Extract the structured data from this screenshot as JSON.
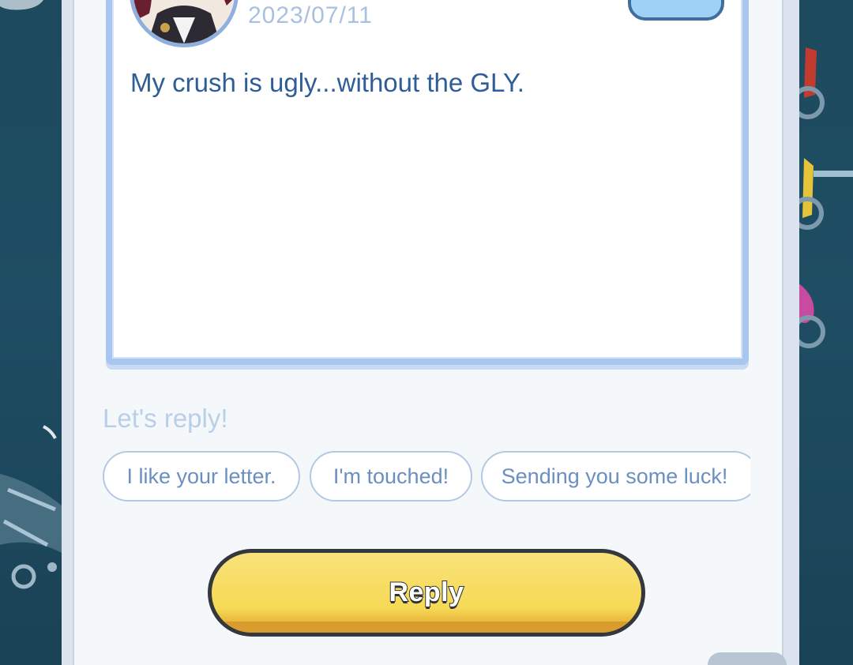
{
  "letter": {
    "date": "2023/07/11",
    "message": "My crush is ugly...without the GLY.",
    "avatar_icon": "character-avatar",
    "add_icon": "plus-icon"
  },
  "reply_section": {
    "hint": "Let's reply!",
    "quick_replies": [
      "I like your letter.",
      "I'm touched!",
      "Sending you some luck!"
    ],
    "reply_button_label": "Reply"
  },
  "colors": {
    "accent_blue": "#2f5d97",
    "button_yellow": "#f6d955",
    "background": "#1f4d63"
  }
}
